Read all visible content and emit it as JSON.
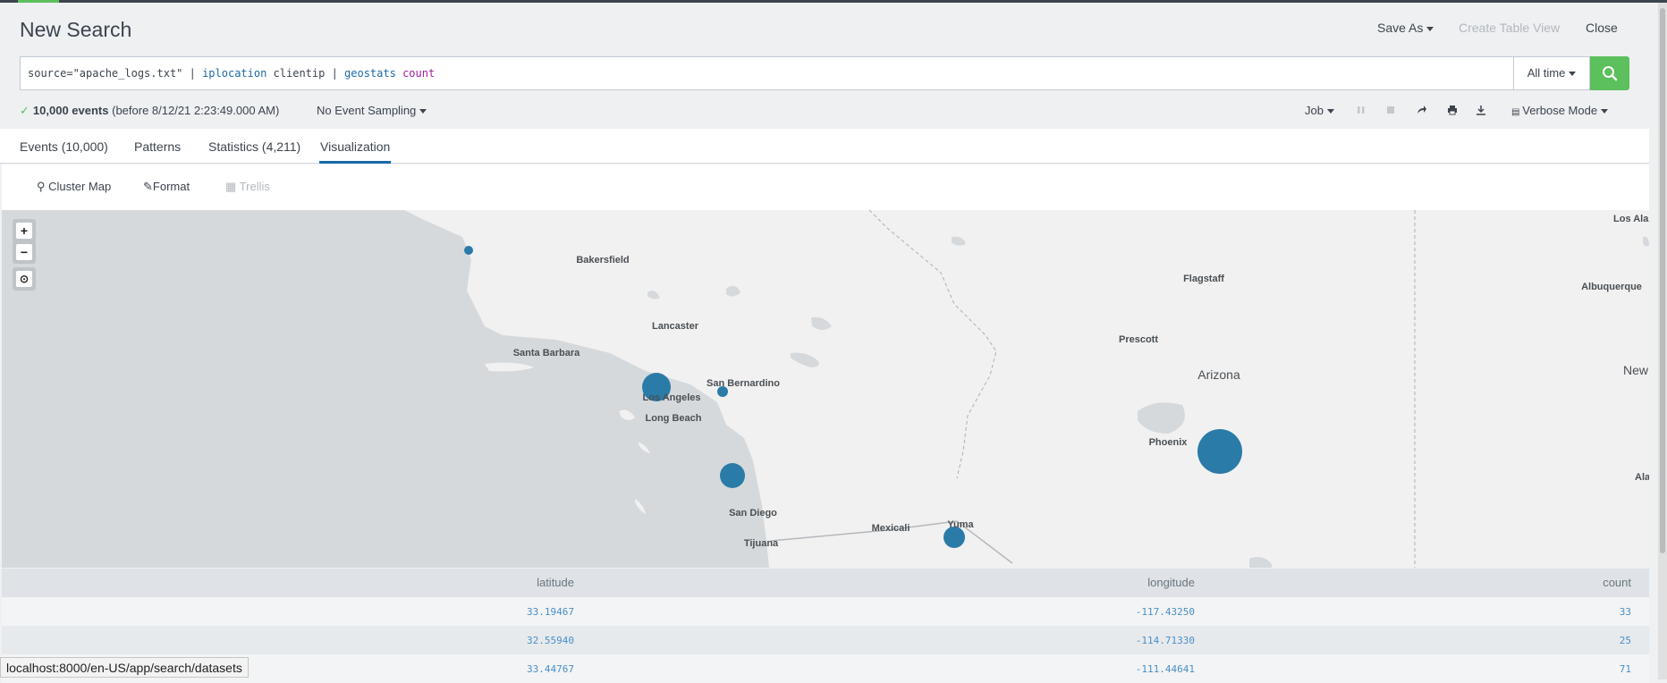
{
  "header": {
    "title": "New Search",
    "save_as": "Save As",
    "create_table_view": "Create Table View",
    "close": "Close"
  },
  "search": {
    "query_source": "source=\"apache_logs.txt\" | ",
    "query_cmd1": "iplocation",
    "query_arg1": " clientip | ",
    "query_cmd2": "geostats",
    "query_fn": "count",
    "time_range": "All time"
  },
  "status": {
    "events": "10,000 events",
    "before": "(before 8/12/21 2:23:49.000 AM)",
    "sampling": "No Event Sampling",
    "job": "Job",
    "mode": "Verbose Mode"
  },
  "tabs": [
    {
      "label": "Events (10,000)"
    },
    {
      "label": "Patterns"
    },
    {
      "label": "Statistics (4,211)"
    },
    {
      "label": "Visualization"
    }
  ],
  "viz_toolbar": {
    "cluster_map": "Cluster Map",
    "format": "Format",
    "trellis": "Trellis"
  },
  "map": {
    "labels": {
      "bakersfield": "Bakersfield",
      "lancaster": "Lancaster",
      "santa_barbara": "Santa Barbara",
      "san_bernardino": "San Bernardino",
      "los_angeles": "Los Angeles",
      "long_beach": "Long Beach",
      "san_diego": "San Diego",
      "tijuana": "Tijuana",
      "mexicali": "Mexicali",
      "yuma": "Yuma",
      "flagstaff": "Flagstaff",
      "prescott": "Prescott",
      "arizona": "Arizona",
      "phoenix": "Phoenix",
      "albuquerque": "Albuquerque",
      "los_alamos": "Los Alar",
      "new_mexico": "New",
      "alamogordo": "Ala"
    },
    "marker_color": "#2a7ba8"
  },
  "table": {
    "headers": {
      "latitude": "latitude",
      "longitude": "longitude",
      "count": "count"
    },
    "rows": [
      {
        "latitude": "33.19467",
        "longitude": "-117.43250",
        "count": "33"
      },
      {
        "latitude": "32.55940",
        "longitude": "-114.71330",
        "count": "25"
      },
      {
        "latitude": "33.44767",
        "longitude": "-111.44641",
        "count": "71"
      }
    ]
  },
  "status_tooltip": "localhost:8000/en-US/app/search/datasets"
}
